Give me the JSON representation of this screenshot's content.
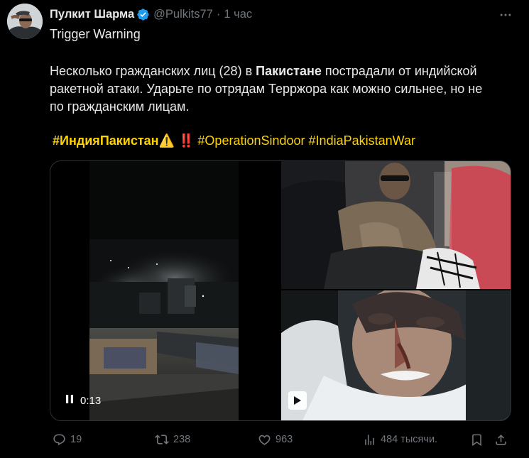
{
  "author": {
    "display_name": "Пулкит Шарма",
    "handle": "@Pulkits77",
    "time": "1 час",
    "verified_color": "#1d9bf0"
  },
  "tweet": {
    "intro": "Trigger Warning",
    "line1_a": "Несколько гражданских лиц (28) в ",
    "line1_bold": "Пакистане",
    "line1_b": " пострадали от индийской",
    "line2": "ракетной атаки. Ударьте по отрядам Терржора как можно сильнее, но не",
    "line3": "по гражданским лицам.",
    "hashtags": {
      "tag1": "#ИндияПакистан",
      "emoji_warning": "⚠️",
      "emoji_bang": "‼️",
      "tag2": "#OperationSindoor",
      "tag3": "#IndiaPakistanWar"
    },
    "hashtag_color": "#ffd400"
  },
  "media": {
    "video_time": "0:13",
    "items": [
      "video",
      "photo",
      "video"
    ]
  },
  "actions": {
    "replies": "19",
    "reposts": "238",
    "likes": "963",
    "views": "484 тысячи."
  },
  "icons": [
    "verified-badge-icon",
    "more-icon",
    "pause-icon",
    "play-icon",
    "reply-icon",
    "repost-icon",
    "like-icon",
    "views-icon",
    "bookmark-icon",
    "share-icon"
  ]
}
